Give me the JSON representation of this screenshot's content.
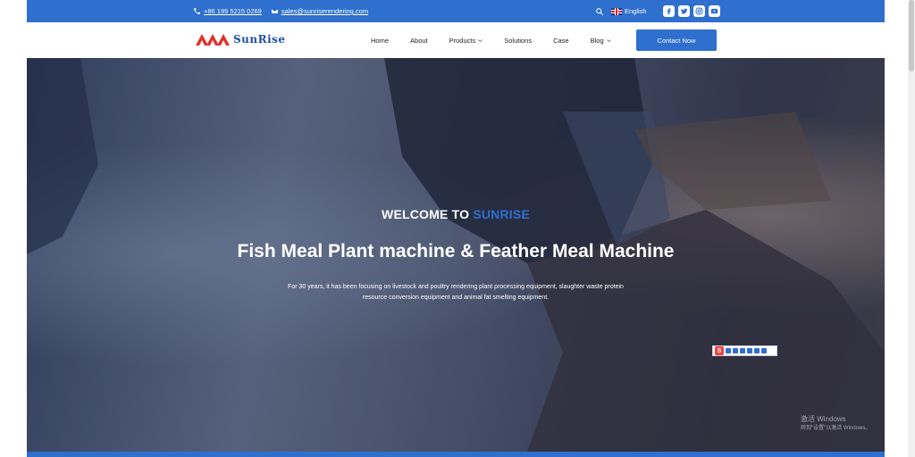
{
  "topbar": {
    "phone": "+86 199 5215 0269",
    "email": "sales@sunriserendering.com",
    "language": "English"
  },
  "brand": {
    "name": "SunRise"
  },
  "nav": {
    "items": [
      {
        "label": "Home"
      },
      {
        "label": "About"
      },
      {
        "label": "Products"
      },
      {
        "label": "Solutions"
      },
      {
        "label": "Case"
      },
      {
        "label": "Blog"
      }
    ],
    "contact_label": "Contact Now"
  },
  "hero": {
    "welcome_prefix": "WELCOME TO ",
    "welcome_brand": "SUNRISE",
    "title": "Fish Meal Plant machine & Feather Meal Machine",
    "description": "For 30 years, it has been focusing on livestock and poultry rendering plant processing equipment, slaughter waste protein resource conversion equipment and animal fat smelting equipment."
  },
  "overlay": {
    "ime_letter": "S",
    "watermark_title": "激活 Windows",
    "watermark_sub": "转到\"设置\"以激活 Windows。"
  },
  "colors": {
    "brand_blue": "#2f6fce",
    "logo_red": "#e0312b"
  }
}
